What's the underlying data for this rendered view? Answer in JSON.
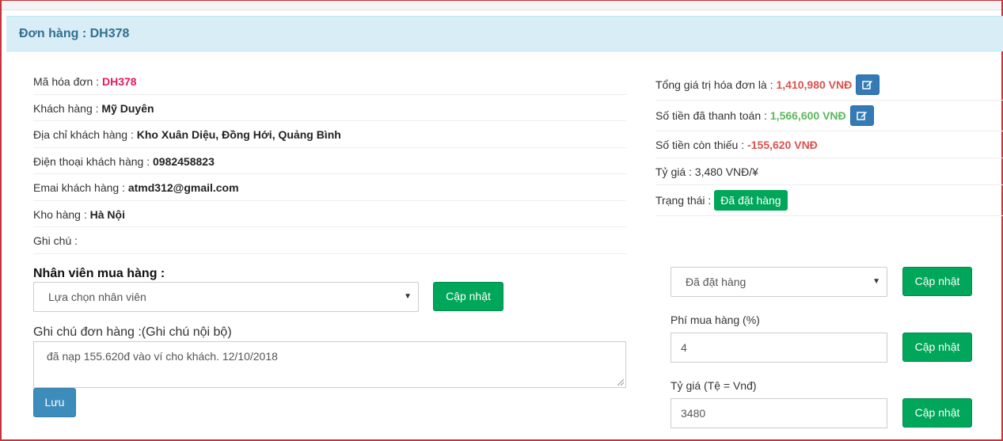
{
  "header": {
    "title": "Đơn hàng : DH378"
  },
  "info": [
    {
      "label": "Mã hóa đơn :",
      "value": "DH378",
      "highlight": true
    },
    {
      "label": "Khách hàng :",
      "value": "Mỹ Duyên"
    },
    {
      "label": "Địa chỉ khách hàng :",
      "value": "Kho Xuân Diệu, Đồng Hới, Quảng Bình"
    },
    {
      "label": "Điện thoại khách hàng :",
      "value": "0982458823"
    },
    {
      "label": "Emai khách hàng :",
      "value": "atmd312@gmail.com"
    },
    {
      "label": "Kho hàng :",
      "value": "Hà Nội"
    },
    {
      "label": "Ghi chú :",
      "value": ""
    }
  ],
  "summary": {
    "total_label": "Tổng giá trị hóa đơn là :",
    "total_value": "1,410,980 VNĐ",
    "paid_label": "Số tiền đã thanh toán :",
    "paid_value": "1,566,600 VNĐ",
    "missing_label": "Số tiền còn thiếu :",
    "missing_value": "-155,620 VNĐ",
    "rate_text": "Tỷ giá : 3,480 VNĐ/¥",
    "status_label": "Trạng thái :",
    "status_value": "Đã đặt hàng"
  },
  "staff": {
    "title": "Nhân viên mua hàng :",
    "select_value": "Lựa chọn nhân viên",
    "update_label": "Cập nhật"
  },
  "note": {
    "label": "Ghi chú đơn hàng :(Ghi chú nội bộ)",
    "value": "đã nạp 155.620đ vào ví cho khách. 12/10/2018",
    "save_label": "Lưu"
  },
  "status_form": {
    "select_value": "Đã đặt hàng",
    "update_label": "Cập nhật"
  },
  "fee_form": {
    "label": "Phí mua hàng (%)",
    "value": "4",
    "update_label": "Cập nhật"
  },
  "rate_form": {
    "label": "Tỷ giá (Tệ = Vnđ)",
    "value": "3480",
    "update_label": "Cập nhật"
  },
  "colors": {
    "accent_green": "#00a65a",
    "accent_blue": "#3c8dbc",
    "heading_bg": "#d9edf7",
    "amount_red": "#d9534f",
    "amount_green": "#5cb85c"
  },
  "icons": {
    "edit": "edit-icon"
  }
}
